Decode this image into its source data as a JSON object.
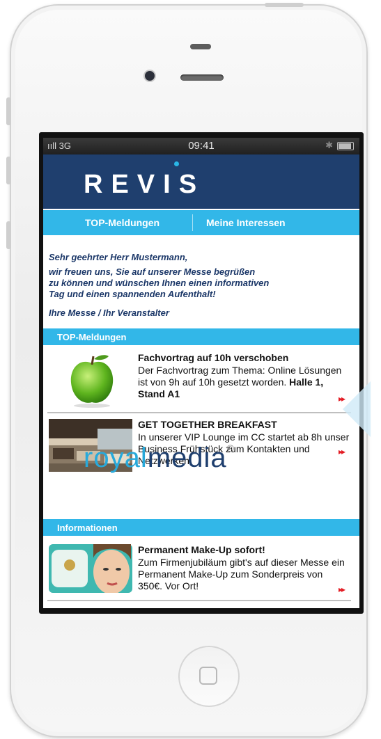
{
  "status_bar": {
    "signal": "ııll 3G",
    "time": "09:41"
  },
  "app": {
    "logo": "REVIS"
  },
  "nav": {
    "tab1": "TOP-Meldungen",
    "tab2": "Meine Interessen"
  },
  "greeting": {
    "lines": [
      "Sehr geehrter Herr Mustermann,",
      "wir freuen uns, Sie auf unserer Messe begrüßen",
      "zu können und wünschen Ihnen einen informativen",
      "Tag und einen spannenden Aufenthalt!"
    ],
    "signature": "Ihre Messe / Ihr Veranstalter"
  },
  "sections": {
    "top": "TOP-Meldungen",
    "info": "Informationen"
  },
  "news": [
    {
      "title": "Fachvortrag auf 10h verschoben",
      "text": "Der Fachvortrag zum Thema: Online Lösungen ist von 9h auf 10h gesetzt worden.",
      "location": "Halle 1, Stand A1"
    },
    {
      "title": "GET TOGETHER BREAKFAST",
      "text": "In unserer VIP Lounge im CC startet ab 8h unser Business Frühstück zum Kontakten und Netzwerken."
    },
    {
      "title": "Permanent Make-Up sofort!",
      "text": "Zum Firmenjubiläum gibt's auf dieser Messe ein Permanent Make-Up zum Sonderpreis von 350€. Vor Ort!"
    }
  ],
  "sponsor": {
    "part1": "royal",
    "part2": "media",
    "mark": "®"
  },
  "arrow_glyph": "▸▸",
  "colors": {
    "header": "#1f3f6e",
    "accent": "#32b7e8",
    "arrow": "#e31b23"
  }
}
